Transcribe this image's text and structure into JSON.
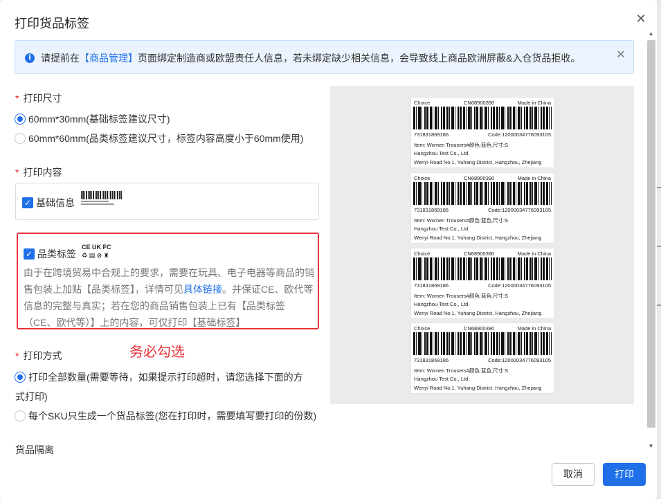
{
  "dialog": {
    "title": "打印货品标签",
    "close_glyph": "✕"
  },
  "notice": {
    "prefix": "请提前在",
    "link": "【商品管理】",
    "suffix": "页面绑定制造商或欧盟责任人信息，若未绑定缺少相关信息，会导致线上商品欧洲屏蔽&入仓货品拒收。",
    "info_glyph": "i",
    "close_glyph": "✕"
  },
  "print_size": {
    "label": "打印尺寸",
    "required_mark": "*",
    "options": [
      {
        "label": "60mm*30mm(基础标签建议尺寸)",
        "checked": true
      },
      {
        "label": "60mm*60mm(品类标签建议尺寸，标签内容高度小于60mm使用)",
        "checked": false
      }
    ]
  },
  "print_content": {
    "label": "打印内容",
    "required_mark": "*",
    "basic": {
      "label": "基础信息",
      "checked": true
    },
    "category": {
      "label": "品类标签",
      "checked": true,
      "marks_line1": "CE UK FC",
      "marks_line2": "♻ ▤ ⊘ ♜",
      "desc_a": "由于在跨境贸易中合规上的要求，需要在玩具、电子电器等商品的销售包装上加贴【品类标签】，详情可见",
      "desc_link": "具体链接",
      "desc_b": "。并保证CE、欧代等信息的完整与真实；若在您的商品销售包装上已有【品类标签（CE、欧代等）】上的内容，可仅打印【基础标签】"
    },
    "check_glyph": "✓"
  },
  "annotation": "务必勾选",
  "print_method": {
    "label": "打印方式",
    "required_mark": "*",
    "options": [
      {
        "label_line1": "打印全部数量(需要等待，如果提示打印超时，请您选择下面的方",
        "label_line2": "式打印)",
        "checked": true
      },
      {
        "label_line1": "每个SKU只生成一个货品标签(您在打印时，需要填写要打印的份数)",
        "checked": false
      }
    ]
  },
  "isolation": {
    "label": "货品隔离"
  },
  "preview_label": {
    "brand": "Choice",
    "cn_code": "CN68900390",
    "origin": "Made in China",
    "sku_code": "731831869186",
    "code": "Code:12000034776093105",
    "item": "Item:  Women Trousers#颜色:蓝色,尺寸:S",
    "company": "Hangzhou Test Co., Ltd.",
    "address": "Wenyi Road  No.1, Yuhang District, Hangzhou, Zhejiang"
  },
  "footer": {
    "cancel_label": "取消",
    "print_label": "打印"
  },
  "scrollbar": {
    "up_glyph": "▲",
    "down_glyph": "▼"
  },
  "colors": {
    "primary": "#1e6fe8",
    "highlight_red": "#e8343a",
    "notice_bg": "#ebf3fe"
  }
}
